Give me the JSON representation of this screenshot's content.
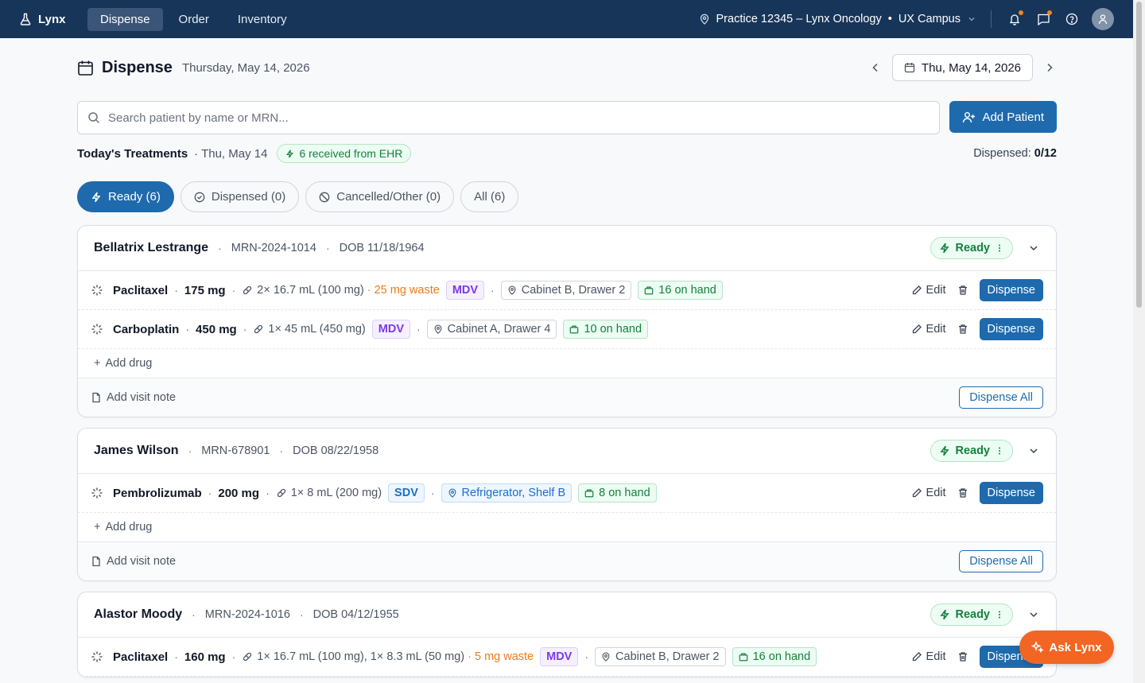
{
  "topbar": {
    "brand": "Lynx",
    "nav": [
      "Dispense",
      "Order",
      "Inventory"
    ],
    "practice": "Practice 12345 – Lynx Oncology",
    "campus": "UX Campus"
  },
  "header": {
    "title": "Dispense",
    "date": "Thursday, May 14, 2026",
    "picker_date": "Thu, May 14, 2026"
  },
  "search": {
    "placeholder": "Search patient by name or MRN..."
  },
  "add_patient_label": "Add Patient",
  "summary": {
    "title": "Today's Treatments",
    "date": "· Thu, May 14",
    "ehr_badge": "6 received from EHR",
    "dispensed_label": "Dispensed:",
    "dispensed_value": "0/12"
  },
  "filters": [
    "Ready (6)",
    "Dispensed (0)",
    "Cancelled/Other (0)",
    "All (6)"
  ],
  "labels": {
    "ready": "Ready",
    "edit": "Edit",
    "dispense": "Dispense",
    "add_drug": "Add drug",
    "add_note": "Add visit note",
    "dispense_all": "Dispense All",
    "ask": "Ask Lynx"
  },
  "patients": [
    {
      "name": "Bellatrix Lestrange",
      "mrn": "MRN-2024-1014",
      "dob": "DOB 11/18/1964",
      "drugs": [
        {
          "name": "Paclitaxel",
          "dose": "175 mg",
          "vials": "2× 16.7 mL (100 mg)",
          "waste": "· 25 mg waste",
          "type": "MDV",
          "location": "Cabinet B, Drawer 2",
          "onhand": "16 on hand"
        },
        {
          "name": "Carboplatin",
          "dose": "450 mg",
          "vials": "1× 45 mL (450 mg)",
          "type": "MDV",
          "location": "Cabinet A, Drawer 4",
          "onhand": "10 on hand"
        }
      ]
    },
    {
      "name": "James Wilson",
      "mrn": "MRN-678901",
      "dob": "DOB 08/22/1958",
      "drugs": [
        {
          "name": "Pembrolizumab",
          "dose": "200 mg",
          "vials": "1× 8 mL (200 mg)",
          "type": "SDV",
          "location": "Refrigerator, Shelf B",
          "onhand": "8 on hand"
        }
      ]
    },
    {
      "name": "Alastor Moody",
      "mrn": "MRN-2024-1016",
      "dob": "DOB 04/12/1955",
      "drugs": [
        {
          "name": "Paclitaxel",
          "dose": "160 mg",
          "vials": "1× 16.7 mL (100 mg), 1× 8.3 mL (50 mg)",
          "waste": "· 5 mg waste",
          "type": "MDV",
          "location": "Cabinet B, Drawer 2",
          "onhand": "16 on hand"
        }
      ]
    }
  ]
}
